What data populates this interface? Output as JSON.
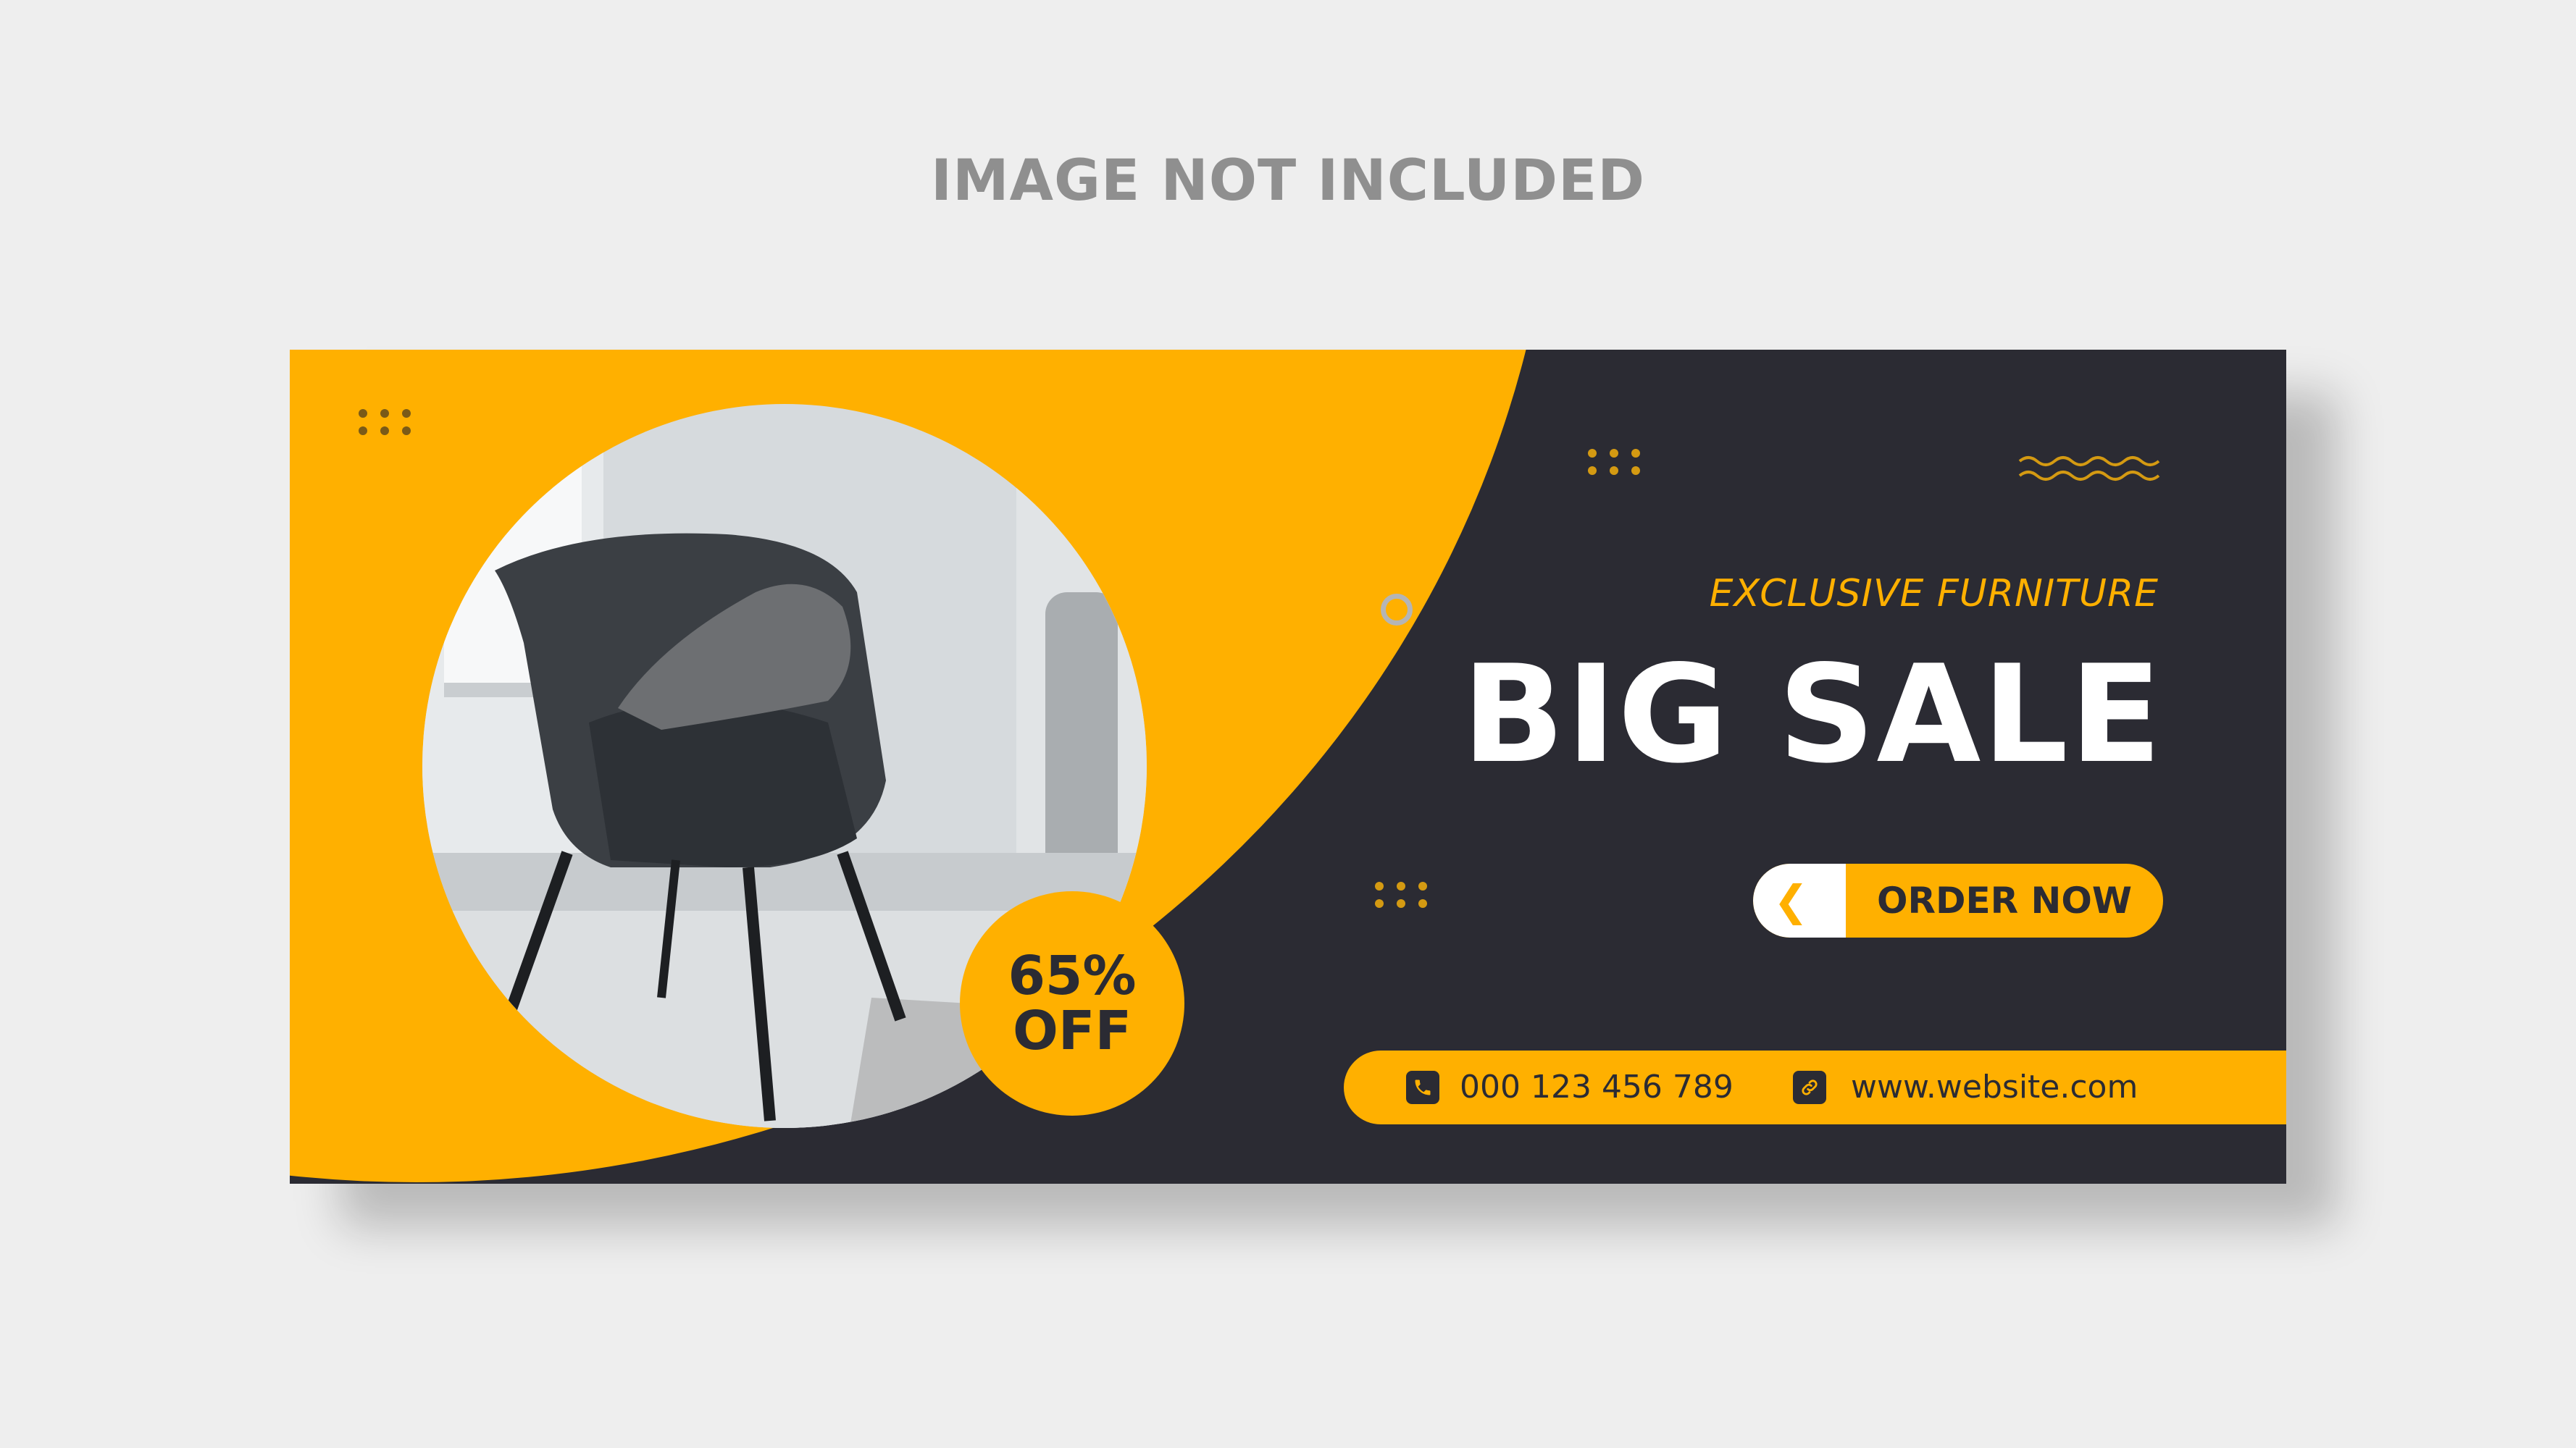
{
  "note": "IMAGE NOT INCLUDED",
  "banner": {
    "tagline": "EXCLUSIVE FURNITURE",
    "headline": "BIG SALE",
    "button_label": "ORDER NOW",
    "discount_line1": "65%",
    "discount_line2": "OFF",
    "phone": "000 123 456 789",
    "website": "www.website.com"
  },
  "colors": {
    "accent": "#ffb000",
    "dark": "#2b2b33",
    "background": "#eeeeee"
  },
  "icons": [
    "phone-icon",
    "link-icon",
    "chevron-left-icon"
  ]
}
